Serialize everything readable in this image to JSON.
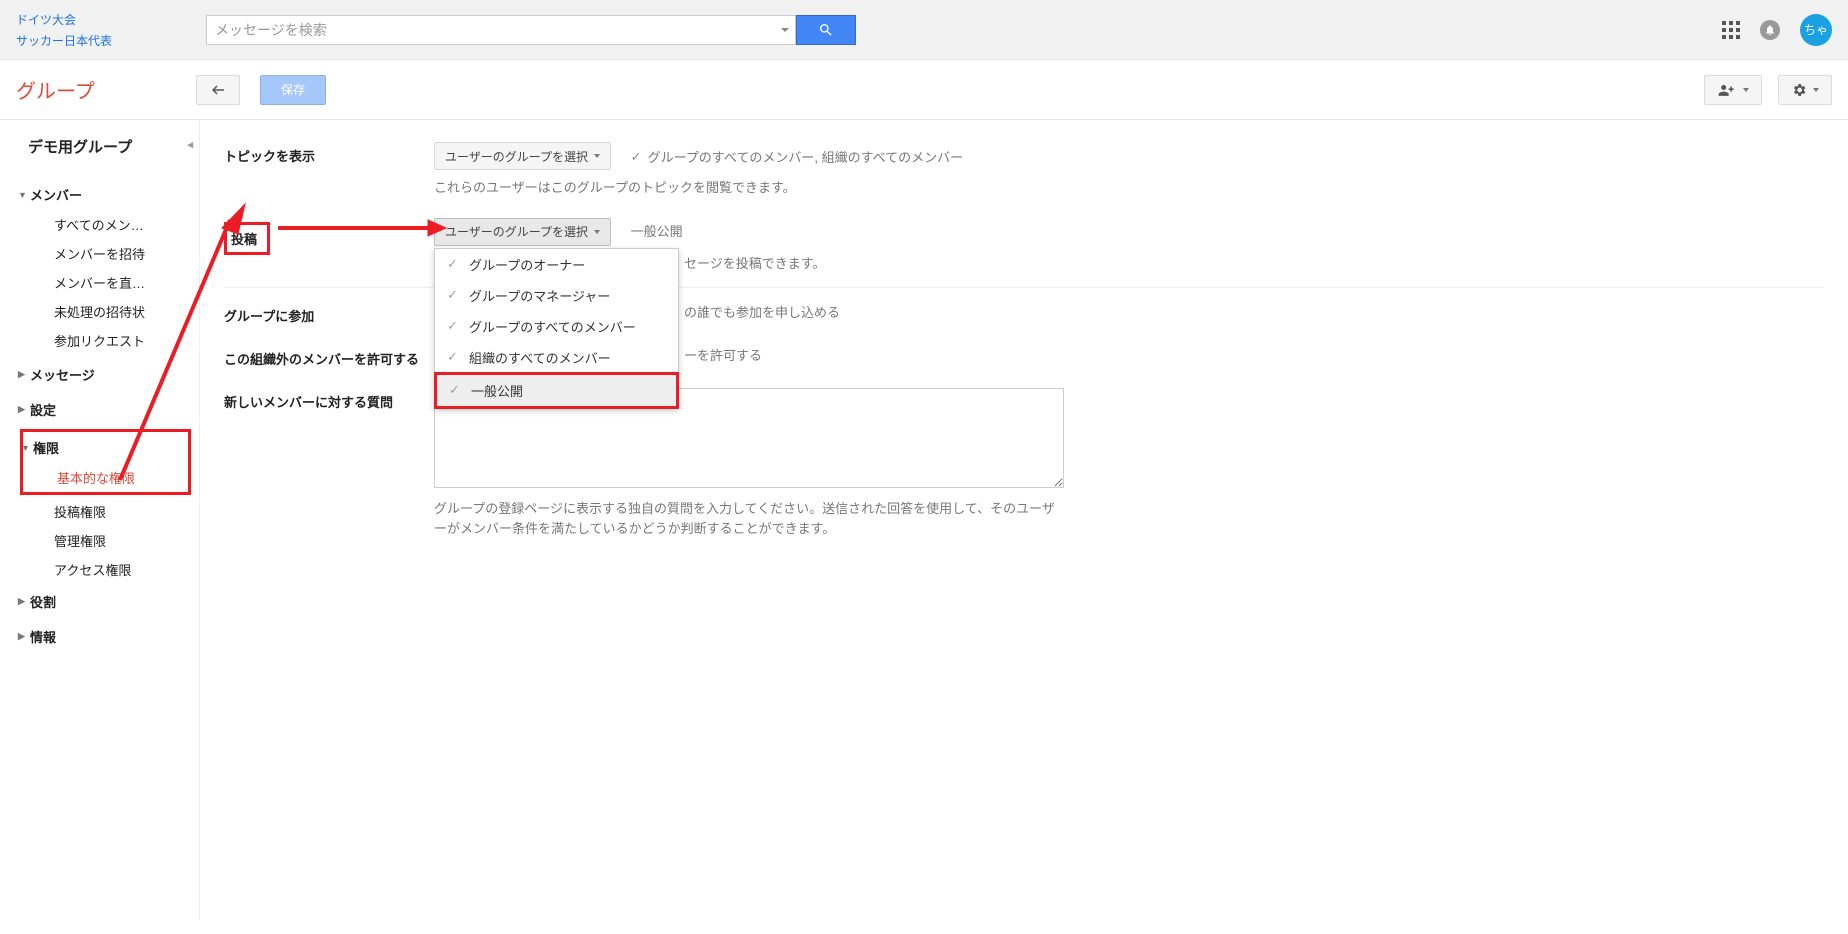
{
  "header": {
    "top_links": [
      "ドイツ大会",
      "サッカー日本代表"
    ],
    "search_placeholder": "メッセージを検索",
    "avatar_label": "ちゃ"
  },
  "actionbar": {
    "brand": "グループ",
    "save": "保存"
  },
  "sidebar": {
    "group_title": "デモ用グループ",
    "sections": [
      {
        "label": "メンバー",
        "expanded": true,
        "items": [
          "すべてのメン…",
          "メンバーを招待",
          "メンバーを直…",
          "未処理の招待状",
          "参加リクエスト"
        ]
      },
      {
        "label": "メッセージ",
        "expanded": false,
        "items": []
      },
      {
        "label": "設定",
        "expanded": false,
        "items": []
      },
      {
        "label": "権限",
        "expanded": true,
        "items": [
          "基本的な権限",
          "投稿権限",
          "管理権限",
          "アクセス権限"
        ]
      },
      {
        "label": "役割",
        "expanded": false,
        "items": []
      },
      {
        "label": "情報",
        "expanded": false,
        "items": []
      }
    ]
  },
  "content": {
    "select_label": "ユーザーのグループを選択",
    "rows": {
      "view": {
        "label": "トピックを表示",
        "note": "グループのすべてのメンバー, 組織のすべてのメンバー",
        "help": "これらのユーザーはこのグループのトピックを閲覧できます。"
      },
      "post": {
        "label": "投稿",
        "note": "一般公開",
        "help_tail": "セージを投稿できます。"
      },
      "join": {
        "label": "グループに参加",
        "note_tail": "の誰でも参加を申し込める"
      },
      "external": {
        "label": "この組織外のメンバーを許可する",
        "note_tail": "ーを許可する"
      },
      "question": {
        "label": "新しいメンバーに対する質問",
        "help": "グループの登録ページに表示する独自の質問を入力してください。送信された回答を使用して、そのユーザーがメンバー条件を満たしているかどうか判断することができます。"
      }
    },
    "dropdown_options": [
      "グループのオーナー",
      "グループのマネージャー",
      "グループのすべてのメンバー",
      "組織のすべてのメンバー",
      "一般公開"
    ]
  }
}
